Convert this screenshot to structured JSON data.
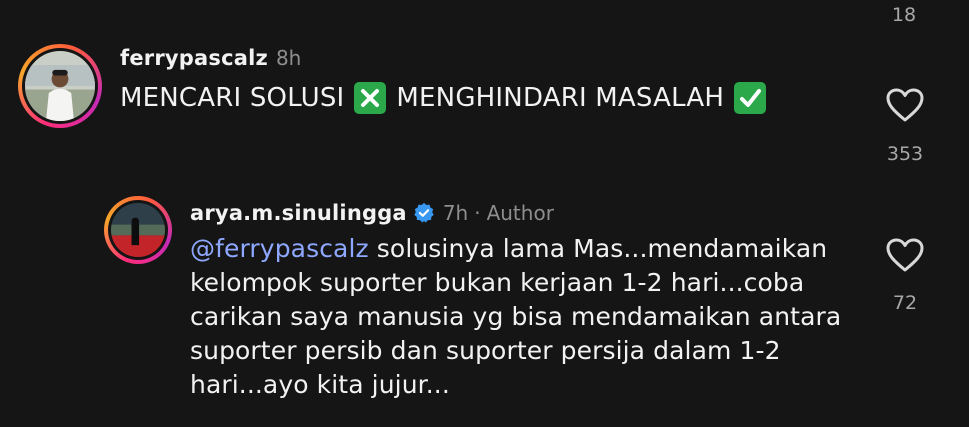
{
  "top_count": "18",
  "comment1": {
    "username": "ferrypascalz",
    "time": "8h",
    "text_part1": "MENCARI SOLUSI",
    "cross_emoji": "cross-mark-emoji",
    "text_part2": "MENGHINDARI MASALAH",
    "check_emoji": "check-mark-emoji",
    "like_count": "353"
  },
  "reply": {
    "username": "arya.m.sinulingga",
    "verified": true,
    "time": "7h",
    "separator": "·",
    "author_label": "Author",
    "mention": "@ferrypascalz",
    "text": " solusinya lama Mas...mendamaikan kelompok suporter bukan kerjaan 1-2 hari...coba carikan saya manusia yg bisa mendamaikan antara suporter persib dan suporter persija dalam 1-2 hari...ayo kita jujur...",
    "like_count": "72"
  },
  "colors": {
    "background": "#151515",
    "mention": "#8fa8ff",
    "verified_badge": "#3897f0",
    "cross_emoji_bg": "#2ba84a",
    "check_emoji_bg": "#2ba84a"
  }
}
